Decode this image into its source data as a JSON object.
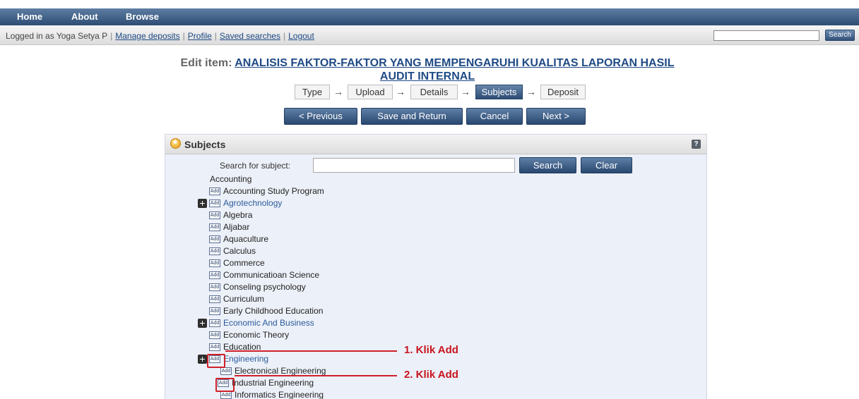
{
  "nav": {
    "items": [
      "Home",
      "About",
      "Browse"
    ]
  },
  "login": {
    "text": "Logged in as Yoga Setya P",
    "links": [
      "Manage deposits",
      "Profile",
      "Saved searches",
      "Logout"
    ],
    "search_button": "Search"
  },
  "title": {
    "prefix": "Edit item:",
    "line1": "ANALISIS FAKTOR-FAKTOR YANG MEMPENGARUHI KUALITAS LAPORAN HASIL",
    "line2": "AUDIT INTERNAL"
  },
  "stages": [
    "Type",
    "Upload",
    "Details",
    "Subjects",
    "Deposit"
  ],
  "arrow_glyph": "→",
  "actions": [
    "< Previous",
    "Save and Return",
    "Cancel",
    "Next >"
  ],
  "panel": {
    "title": "Subjects",
    "help": "?",
    "search_label": "Search for subject:",
    "search_button": "Search",
    "clear_button": "Clear"
  },
  "tree": {
    "root": "Accounting",
    "add_label": "Add",
    "items": [
      "Accounting Study Program",
      "Agrotechnology",
      "Algebra",
      "Aljabar",
      "Aquaculture",
      "Calculus",
      "Commerce",
      "Communicatioan Science",
      "Conseling psychology",
      "Curriculum",
      "Early Childhood Education",
      "Economic And Business",
      "Economic Theory",
      "Education",
      "Engineering"
    ],
    "children": [
      "Electronical Engineering",
      "Industrial Engineering",
      "Informatics Engineering"
    ]
  },
  "annotations": [
    "1. Klik Add",
    "2. Klik Add"
  ],
  "colors": {
    "nav_bar": "#2e4d74",
    "panel_bg": "#ecf0f8",
    "link": "#1f4a86",
    "annotation": "#d0202a"
  }
}
